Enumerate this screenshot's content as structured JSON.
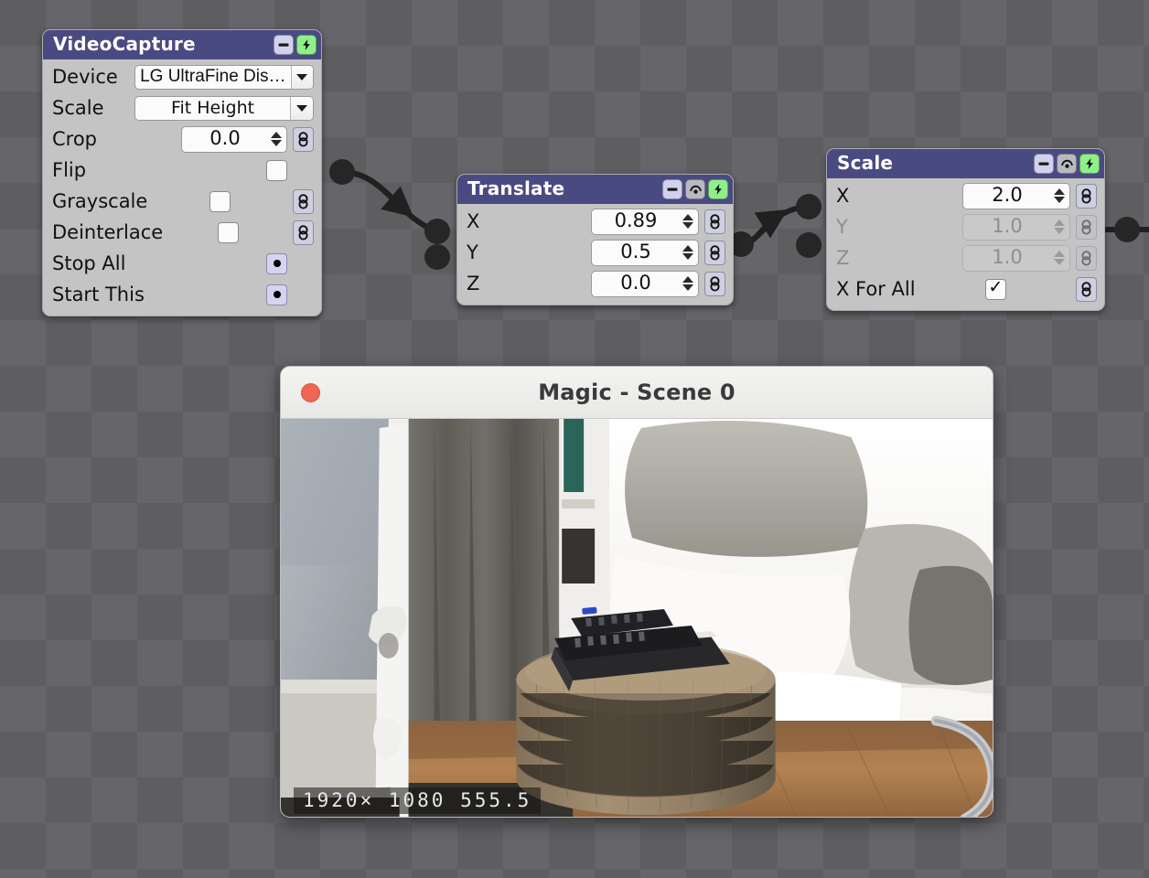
{
  "app": {
    "background": "#5e5e61",
    "accent_header": "#4a4a82",
    "accent_bolt": "#8ff08a",
    "accent_link": "#cfcfe2"
  },
  "nodes": [
    {
      "id": "videocapture",
      "title": "VideoCapture",
      "header_buttons": [
        "minimize-icon",
        "bolt-icon"
      ],
      "rows": [
        {
          "label": "Device",
          "type": "combo",
          "value": "LG UltraFine Dis…",
          "icon": "chevron-down-icon"
        },
        {
          "label": "Scale",
          "type": "combo",
          "value": "Fit Height",
          "icon": "chevron-down-icon"
        },
        {
          "label": "Crop",
          "type": "spin",
          "value": "0.0",
          "link": true
        },
        {
          "label": "Flip",
          "type": "check",
          "checked": false,
          "link": false
        },
        {
          "label": "Grayscale",
          "type": "check",
          "checked": false,
          "link": true
        },
        {
          "label": "Deinterlace",
          "type": "check",
          "checked": false,
          "link": true
        },
        {
          "label": "Stop All",
          "type": "radio",
          "checked": true,
          "link": false
        },
        {
          "label": "Start This",
          "type": "radio",
          "checked": true,
          "link": false
        }
      ]
    },
    {
      "id": "translate",
      "title": "Translate",
      "header_buttons": [
        "minimize-icon",
        "reset-icon",
        "bolt-icon"
      ],
      "rows": [
        {
          "label": "X",
          "type": "spin",
          "value": "0.89",
          "link": true,
          "dim": false
        },
        {
          "label": "Y",
          "type": "spin",
          "value": "0.5",
          "link": true,
          "dim": false
        },
        {
          "label": "Z",
          "type": "spin",
          "value": "0.0",
          "link": true,
          "dim": false
        }
      ]
    },
    {
      "id": "scale",
      "title": "Scale",
      "header_buttons": [
        "minimize-icon",
        "reset-icon",
        "bolt-icon"
      ],
      "rows": [
        {
          "label": "X",
          "type": "spin",
          "value": "2.0",
          "link": true,
          "dim": false
        },
        {
          "label": "Y",
          "type": "spin",
          "value": "1.0",
          "link": true,
          "dim": true
        },
        {
          "label": "Z",
          "type": "spin",
          "value": "1.0",
          "link": true,
          "dim": true
        },
        {
          "label": "X For All",
          "type": "check",
          "checked": true,
          "link": true
        }
      ]
    }
  ],
  "preview": {
    "title": "Magic - Scene 0",
    "close_icon": "close-icon",
    "osd": "1920× 1080  555.5"
  }
}
